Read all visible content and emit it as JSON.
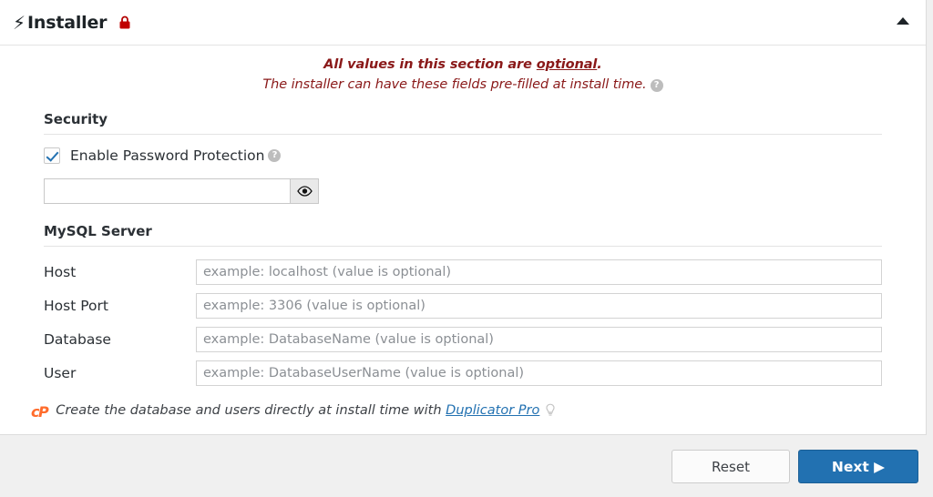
{
  "header": {
    "bolt_icon": "bolt-icon",
    "title": "Installer",
    "lock_icon": "lock-icon",
    "collapse_icon": "caret-up-icon"
  },
  "notice": {
    "line1_prefix": "All values in this section are ",
    "line1_emphasis": "optional",
    "line1_suffix": ".",
    "line2": "The installer can have these fields pre-filled at install time.",
    "help_icon": "help-icon",
    "color": "#8a1919"
  },
  "security": {
    "title": "Security",
    "checkbox_label": "Enable Password Protection",
    "checkbox_checked": true,
    "checkbox_help_icon": "help-icon",
    "password_value": "",
    "password_placeholder": "",
    "eye_icon": "eye-icon"
  },
  "mysql": {
    "title": "MySQL Server",
    "fields": [
      {
        "label": "Host",
        "value": "",
        "placeholder": "example: localhost (value is optional)"
      },
      {
        "label": "Host Port",
        "value": "",
        "placeholder": "example: 3306 (value is optional)"
      },
      {
        "label": "Database",
        "value": "",
        "placeholder": "example: DatabaseName (value is optional)"
      },
      {
        "label": "User",
        "value": "",
        "placeholder": "example: DatabaseUserName (value is optional)"
      }
    ]
  },
  "note": {
    "logo_icon": "cpanel-logo-icon",
    "logo_text": "cP",
    "text_prefix": "Create the database and users directly at install time with ",
    "link_text": "Duplicator Pro",
    "bulb_icon": "lightbulb-icon"
  },
  "buttons": {
    "reset_label": "Reset",
    "next_label": "Next ▶",
    "accent_color": "#2271b1"
  }
}
